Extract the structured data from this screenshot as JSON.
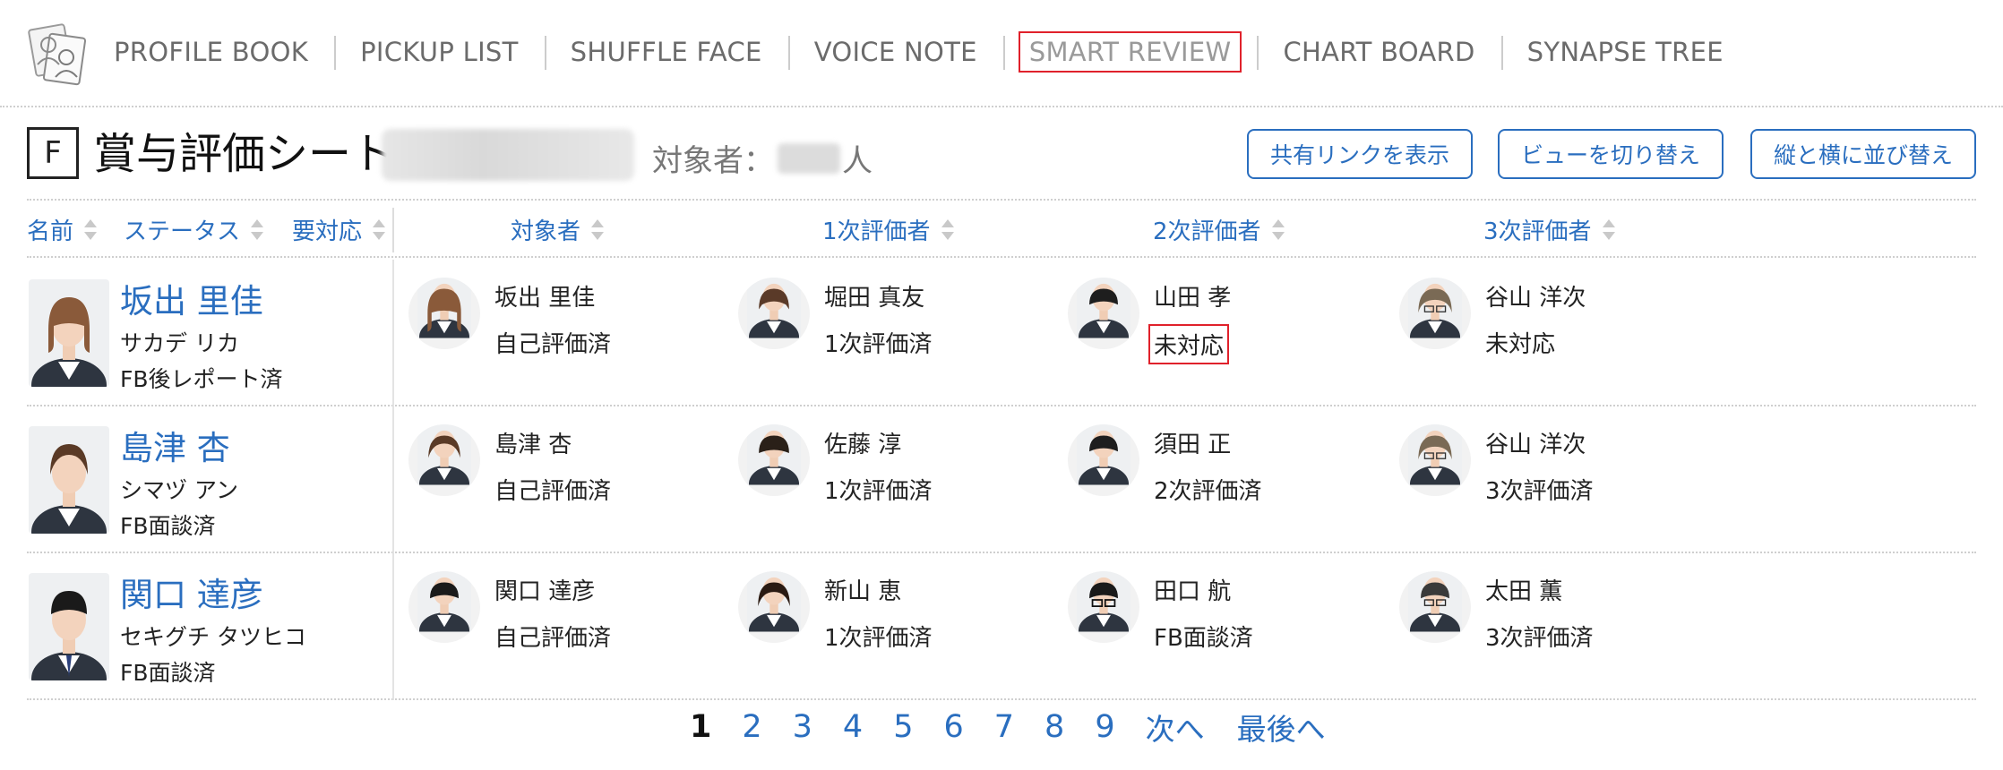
{
  "nav": {
    "items": [
      {
        "label": "PROFILE BOOK"
      },
      {
        "label": "PICKUP LIST"
      },
      {
        "label": "SHUFFLE FACE"
      },
      {
        "label": "VOICE NOTE"
      },
      {
        "label": "SMART REVIEW",
        "active": true
      },
      {
        "label": "CHART BOARD"
      },
      {
        "label": "SYNAPSE TREE"
      }
    ]
  },
  "header": {
    "badge": "F",
    "title": "賞与評価シート",
    "target_label": "対象者：",
    "target_unit": "人",
    "buttons": {
      "share": "共有リンクを表示",
      "view": "ビューを切り替え",
      "sort": "縦と横に並び替え"
    }
  },
  "columns": {
    "name": "名前",
    "status": "ステータス",
    "action": "要対応",
    "subject": "対象者",
    "r1": "1次評価者",
    "r2": "2次評価者",
    "r3": "3次評価者"
  },
  "rows": [
    {
      "name": "坂出 里佳",
      "kana": "サカデ リカ",
      "status": "FB後レポート済",
      "subject": {
        "name": "坂出 里佳",
        "status": "自己評価済"
      },
      "r1": {
        "name": "堀田 真友",
        "status": "1次評価済"
      },
      "r2": {
        "name": "山田 孝",
        "status": "未対応"
      },
      "r3": {
        "name": "谷山 洋次",
        "status": "未対応"
      }
    },
    {
      "name": "島津 杏",
      "kana": "シマヅ アン",
      "status": "FB面談済",
      "subject": {
        "name": "島津 杏",
        "status": "自己評価済"
      },
      "r1": {
        "name": "佐藤 淳",
        "status": "1次評価済"
      },
      "r2": {
        "name": "須田 正",
        "status": "2次評価済"
      },
      "r3": {
        "name": "谷山 洋次",
        "status": "3次評価済"
      }
    },
    {
      "name": "関口 達彦",
      "kana": "セキグチ タツヒコ",
      "status": "FB面談済",
      "subject": {
        "name": "関口 達彦",
        "status": "自己評価済"
      },
      "r1": {
        "name": "新山 恵",
        "status": "1次評価済"
      },
      "r2": {
        "name": "田口 航",
        "status": "FB面談済"
      },
      "r3": {
        "name": "太田 薫",
        "status": "3次評価済"
      }
    }
  ],
  "pager": {
    "pages": [
      "1",
      "2",
      "3",
      "4",
      "5",
      "6",
      "7",
      "8",
      "9"
    ],
    "current": "1",
    "next": "次へ",
    "last": "最後へ"
  },
  "colors": {
    "link": "#2a6ebf",
    "highlight": "#e0212b",
    "nav_text": "#6b6b6b"
  }
}
